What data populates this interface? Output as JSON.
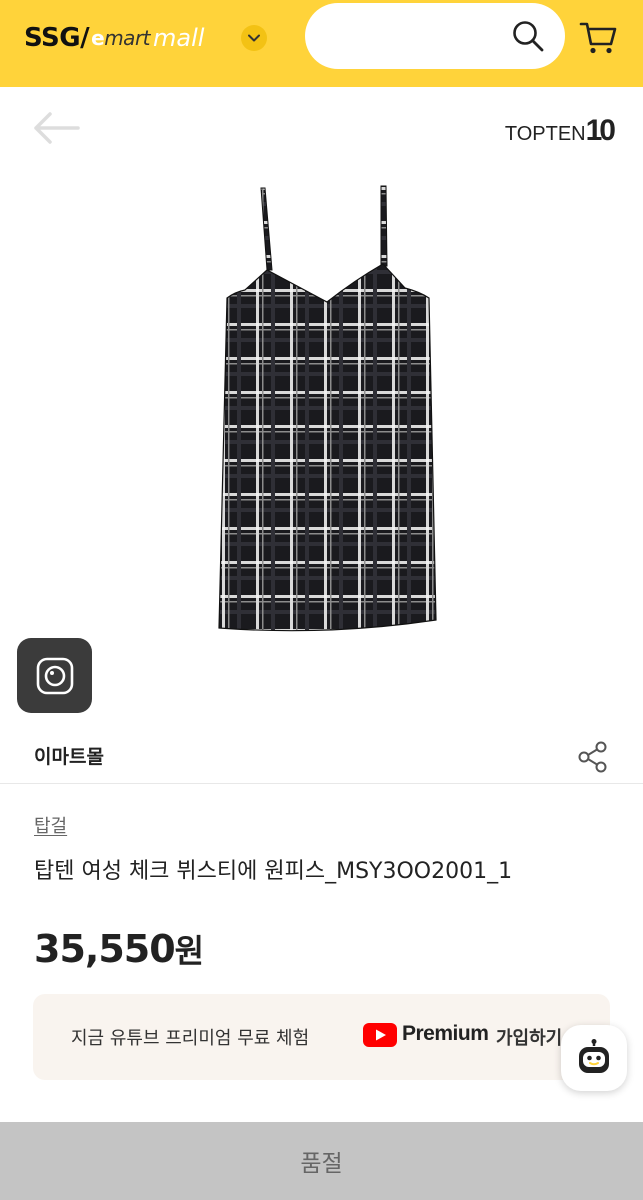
{
  "header": {
    "logo_ssg": "SSG/",
    "logo_emart_e": "e",
    "logo_emart": "mart",
    "logo_mall": "mall",
    "search_value": "",
    "colors": {
      "header_bg": "#ffd33a"
    },
    "icons": [
      "chevron-down-icon",
      "search-icon",
      "cart-icon"
    ]
  },
  "product_view": {
    "brand_logo_text": "TOPTEN",
    "brand_logo_number": "10",
    "icons": [
      "back-arrow-icon",
      "camera-lens-icon"
    ]
  },
  "seller": {
    "name": "이마트몰",
    "icons": [
      "share-icon"
    ]
  },
  "product": {
    "brand": "탑걸",
    "title": "탑텐 여성 체크 뷔스티에 원피스_MSY3OO2001_1",
    "price": "35,550",
    "currency": "원"
  },
  "promo": {
    "text": "지금 유튜브 프리미엄 무료 체험",
    "logo_text": "Premium",
    "join_label": "가입하기",
    "icons": [
      "youtube-icon",
      "chatbot-icon"
    ]
  },
  "footer": {
    "soldout_label": "품절",
    "colors": {
      "bar_bg": "#c4c4c4"
    }
  }
}
